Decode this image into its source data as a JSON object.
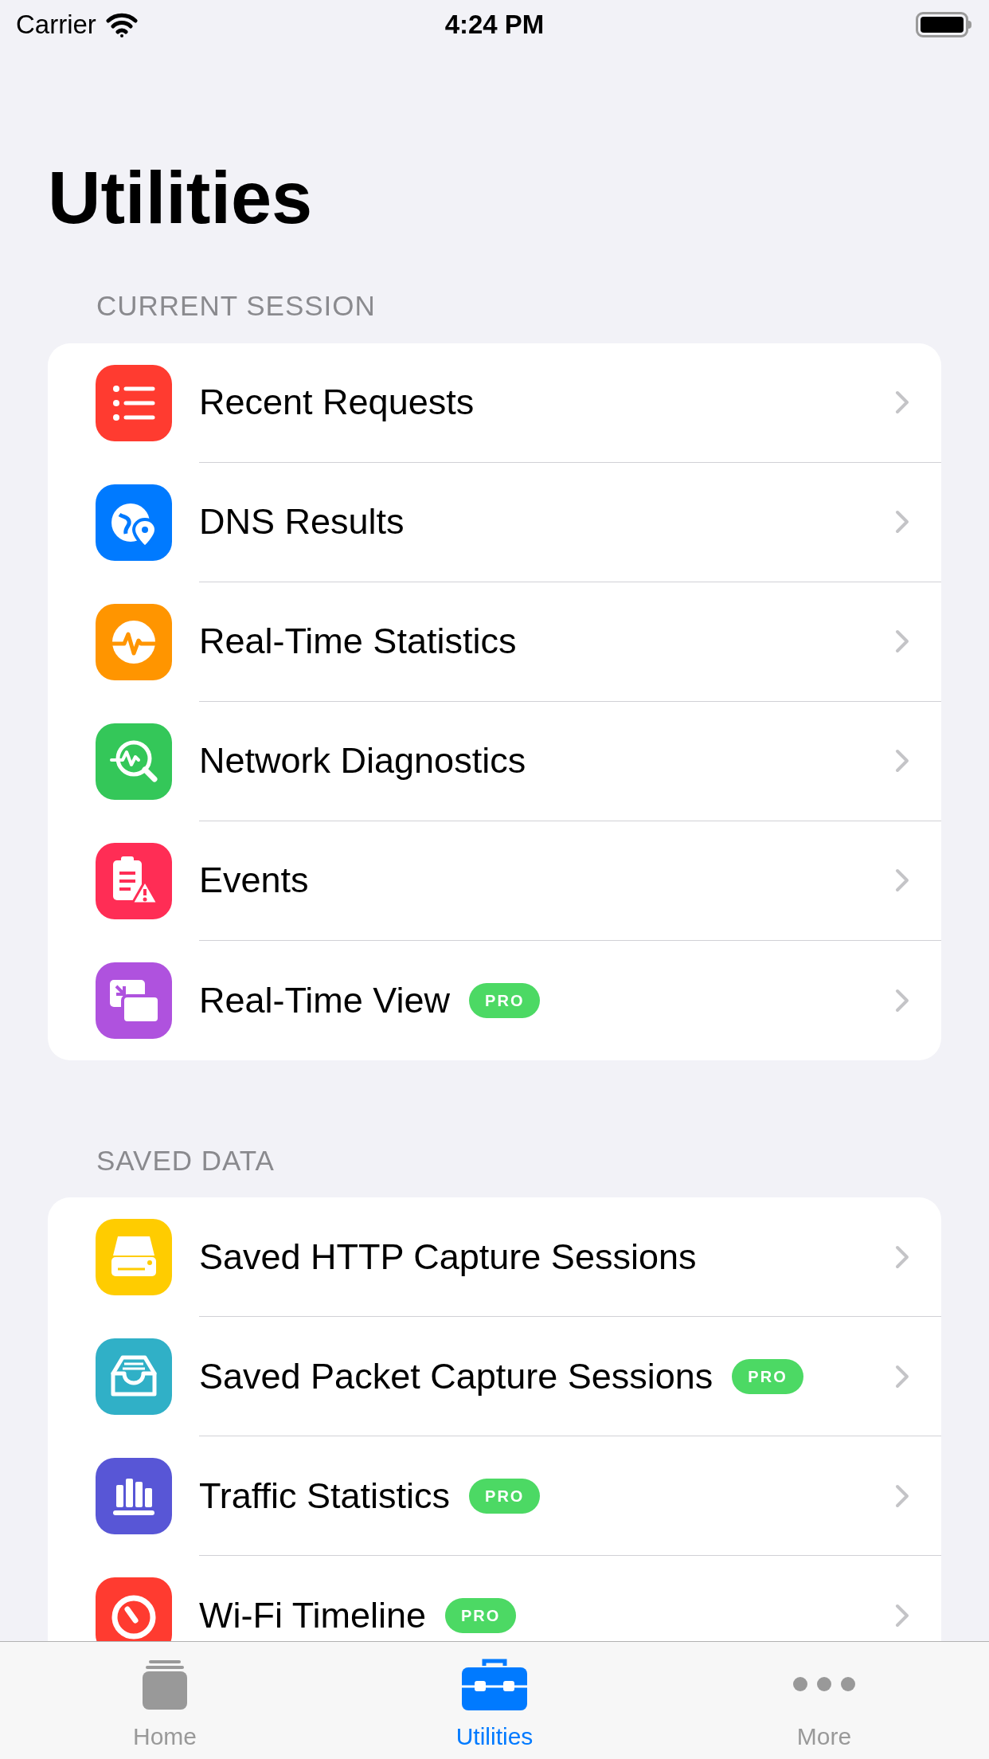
{
  "status_bar": {
    "carrier": "Carrier",
    "time": "4:24 PM"
  },
  "title": "Utilities",
  "sections": [
    {
      "header": "CURRENT SESSION",
      "rows": [
        {
          "label": "Recent Requests",
          "color": "#ff3b30"
        },
        {
          "label": "DNS Results",
          "color": "#007aff"
        },
        {
          "label": "Real-Time Statistics",
          "color": "#ff9500"
        },
        {
          "label": "Network Diagnostics",
          "color": "#34c759"
        },
        {
          "label": "Events",
          "color": "#ff2d55"
        },
        {
          "label": "Real-Time View",
          "color": "#af52de",
          "badge": "PRO"
        }
      ]
    },
    {
      "header": "SAVED DATA",
      "rows": [
        {
          "label": "Saved HTTP Capture Sessions",
          "color": "#ffcc00"
        },
        {
          "label": "Saved Packet Capture Sessions",
          "color": "#30b0c7",
          "badge": "PRO"
        },
        {
          "label": "Traffic Statistics",
          "color": "#5856d6",
          "badge": "PRO"
        },
        {
          "label": "Wi-Fi Timeline",
          "color": "#ff3b30",
          "badge": "PRO"
        }
      ]
    }
  ],
  "tab_bar": [
    {
      "label": "Home",
      "selected": false
    },
    {
      "label": "Utilities",
      "selected": true
    },
    {
      "label": "More",
      "selected": false
    }
  ]
}
